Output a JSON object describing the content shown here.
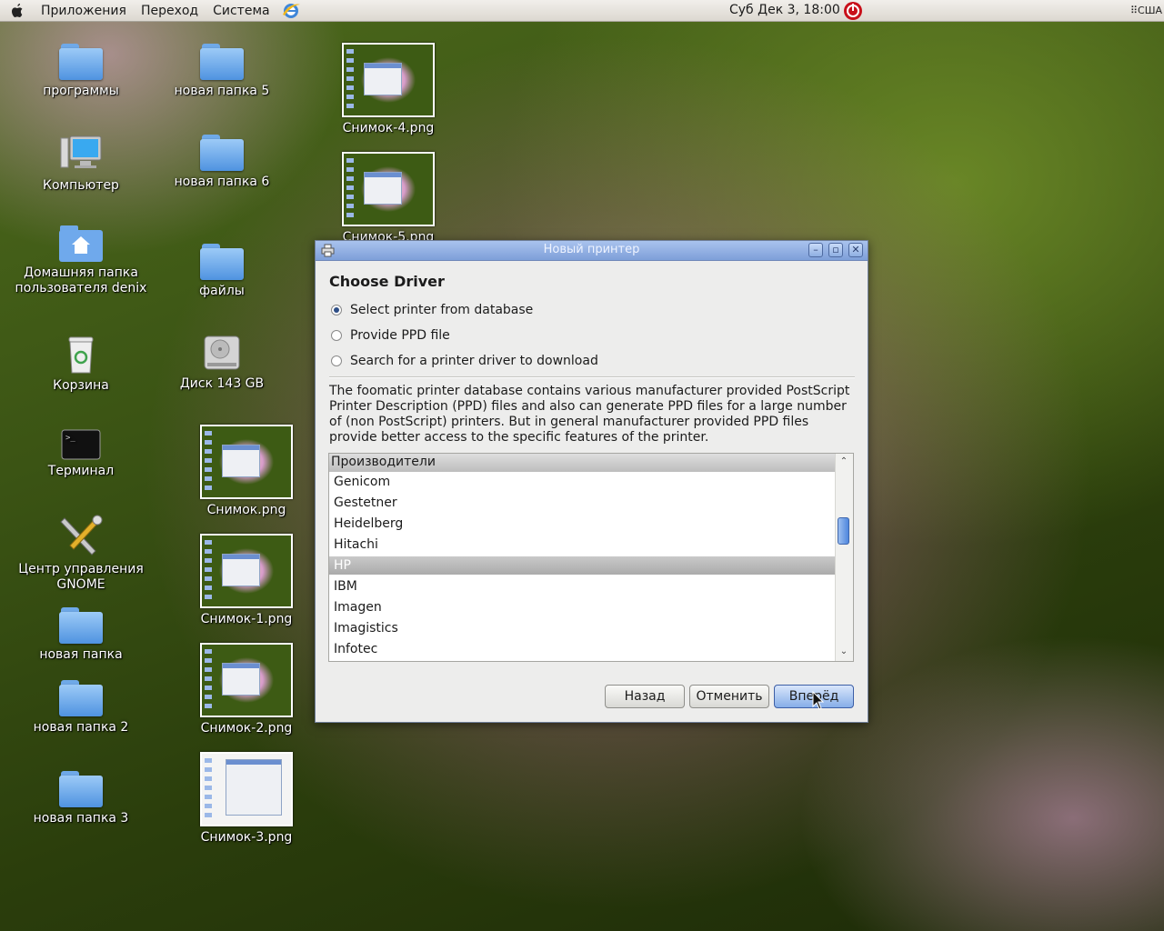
{
  "panel": {
    "menus": [
      "Приложения",
      "Переход",
      "Система"
    ],
    "clock": "Суб Дек  3, 18:00",
    "keyboard": "США"
  },
  "desktop": {
    "icons": [
      {
        "label": "программы",
        "icon": "folder-icon"
      },
      {
        "label": "новая папка 5",
        "icon": "folder-icon"
      },
      {
        "label": "Компьютер",
        "icon": "computer-icon"
      },
      {
        "label": "новая папка 6",
        "icon": "folder-icon"
      },
      {
        "label": "Домашняя папка пользователя denix",
        "icon": "home-folder-icon"
      },
      {
        "label": "файлы",
        "icon": "folder-icon"
      },
      {
        "label": "Корзина",
        "icon": "trash-icon"
      },
      {
        "label": "Диск 143 GB",
        "icon": "disk-icon"
      },
      {
        "label": "Терминал",
        "icon": "terminal-icon"
      },
      {
        "label": "Центр управления GNOME",
        "icon": "tools-icon"
      },
      {
        "label": "новая папка",
        "icon": "folder-icon"
      },
      {
        "label": "новая папка 2",
        "icon": "folder-icon"
      },
      {
        "label": "новая папка 3",
        "icon": "folder-icon"
      },
      {
        "label": "Снимок-4.png",
        "icon": "image-thumbnail"
      },
      {
        "label": "Снимок-5.png",
        "icon": "image-thumbnail"
      },
      {
        "label": "Снимок.png",
        "icon": "image-thumbnail"
      },
      {
        "label": "Снимок-1.png",
        "icon": "image-thumbnail"
      },
      {
        "label": "Снимок-2.png",
        "icon": "image-thumbnail"
      },
      {
        "label": "Снимок-3.png",
        "icon": "image-thumbnail"
      }
    ]
  },
  "dialog": {
    "title": "Новый принтер",
    "heading": "Choose Driver",
    "options": [
      {
        "label": "Select printer from database",
        "checked": true
      },
      {
        "label": "Provide PPD file",
        "checked": false
      },
      {
        "label": "Search for a printer driver to download",
        "checked": false
      }
    ],
    "description": "The foomatic printer database contains various manufacturer provided PostScript Printer Description (PPD) files and also can generate PPD files for a large number of (non PostScript) printers. But in general manufacturer provided PPD files provide better access to the specific features of the printer.",
    "list": {
      "header": "Производители",
      "items": [
        "Genicom",
        "Gestetner",
        "Heidelberg",
        "Hitachi",
        "HP",
        "IBM",
        "Imagen",
        "Imagistics",
        "Infotec"
      ],
      "selected": "HP"
    },
    "buttons": {
      "back": "Назад",
      "cancel": "Отменить",
      "forward": "Вперёд"
    }
  }
}
